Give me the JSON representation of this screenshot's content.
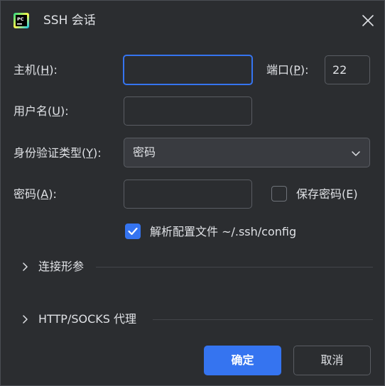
{
  "window": {
    "title": "SSH 会话",
    "app_icon": "pycharm-icon",
    "close_icon": "close-icon"
  },
  "form": {
    "host": {
      "label_prefix": "主机(",
      "mnemonic": "H",
      "label_suffix": "):",
      "value": "",
      "focused": true
    },
    "port": {
      "label_prefix": "端口(",
      "mnemonic": "P",
      "label_suffix": "):",
      "value": "22"
    },
    "username": {
      "label_prefix": "用户名(",
      "mnemonic": "U",
      "label_suffix": "):",
      "value": ""
    },
    "auth_type": {
      "label_prefix": "身份验证类型(",
      "mnemonic": "Y",
      "label_suffix": "):",
      "selected": "密码",
      "options": [
        "密码"
      ]
    },
    "password": {
      "label_prefix": "密码(",
      "mnemonic": "A",
      "label_suffix": "):",
      "value": ""
    },
    "save_password": {
      "label": "保存密码(E)",
      "checked": false
    },
    "parse_config": {
      "label": "解析配置文件 ~/.ssh/config",
      "checked": true
    }
  },
  "sections": [
    {
      "label": "连接形参",
      "expanded": false,
      "icon": "chevron-right-icon"
    },
    {
      "label": "HTTP/SOCKS 代理",
      "expanded": false,
      "icon": "chevron-right-icon"
    }
  ],
  "buttons": {
    "ok": "确定",
    "cancel": "取消"
  },
  "colors": {
    "background": "#2b2d30",
    "accent": "#3574f0",
    "text": "#dfe1e5",
    "border": "#5a5d63"
  }
}
